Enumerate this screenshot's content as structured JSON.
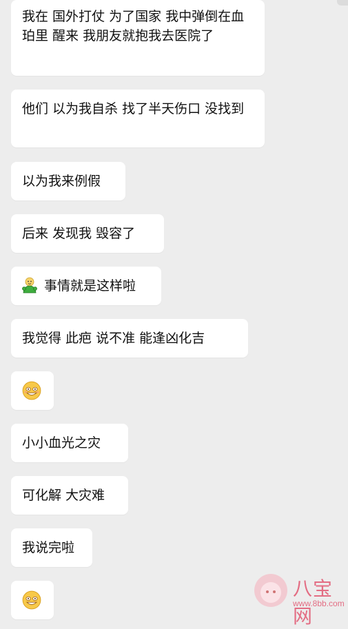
{
  "messages": [
    {
      "text": "我在 国外打仗 为了国家 我中弹倒在血珀里 醒来 我朋友就抱我去医院了"
    },
    {
      "text": "他们 以为我自杀 找了半天伤口 没找到"
    },
    {
      "text": "以为我来例假"
    },
    {
      "text": "后来 发现我 毁容了"
    },
    {
      "text": "事情就是这样啦",
      "icon": "green-guy-emoji"
    },
    {
      "text": "我觉得 此疤 说不准 能逢凶化吉"
    },
    {
      "text": "",
      "icon": "grinning-face-emoji"
    },
    {
      "text": "小小血光之灾"
    },
    {
      "text": "可化解 大灾难"
    },
    {
      "text": "我说完啦"
    },
    {
      "text": "",
      "icon": "grinning-face-emoji"
    }
  ],
  "watermark": {
    "title": "八宝网",
    "site": "www.8bb.com"
  },
  "colors": {
    "background": "#ededed",
    "bubble": "#ffffff",
    "watermark": "#e36d83"
  }
}
